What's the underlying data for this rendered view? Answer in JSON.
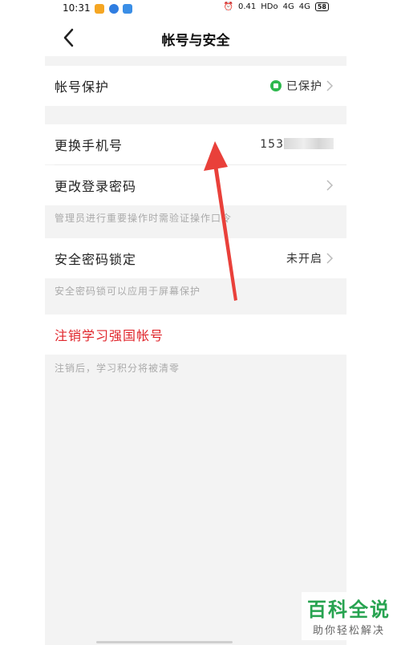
{
  "status_bar": {
    "time": "10:31",
    "speed": "0.41",
    "hd": "HDo",
    "signal1": "4G",
    "signal2": "4G",
    "battery": "58"
  },
  "header": {
    "title": "帐号与安全"
  },
  "account_protection": {
    "label": "帐号保护",
    "status": "已保护"
  },
  "change_phone": {
    "label": "更换手机号",
    "value_prefix": "153"
  },
  "change_password": {
    "label": "更改登录密码"
  },
  "password_hint": "管理员进行重要操作时需验证操作口令",
  "security_lock": {
    "label": "安全密码锁定",
    "status": "未开启"
  },
  "security_hint": "安全密码锁可以应用于屏幕保护",
  "deregister": {
    "label": "注销学习强国帐号",
    "hint": "注销后，学习积分将被清零"
  },
  "watermark": {
    "title": "百科全说",
    "subtitle": "助你轻松解决"
  },
  "colors": {
    "accent_red": "#e0252b",
    "shield_green": "#2db84d",
    "arrow_red": "#e9403a",
    "watermark_green": "#27a350"
  }
}
